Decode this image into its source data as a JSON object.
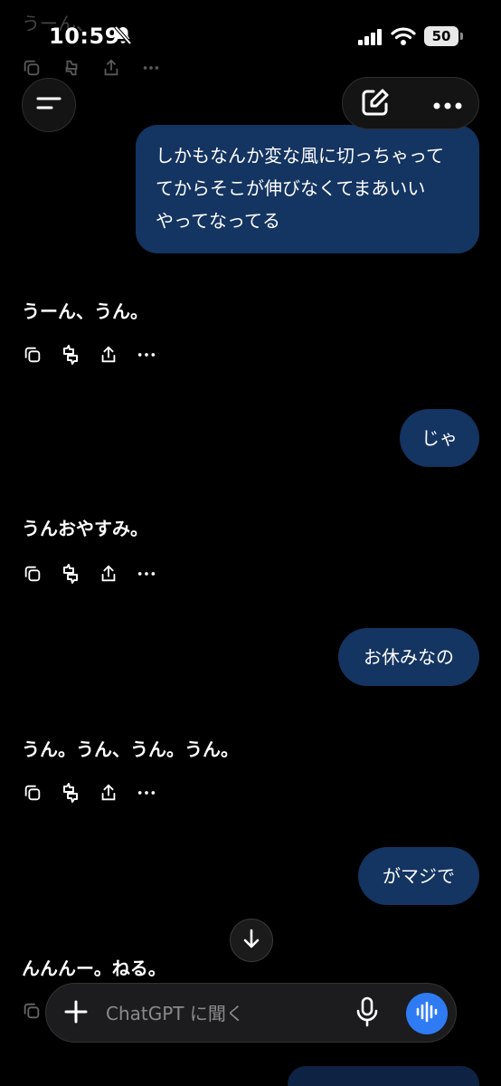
{
  "status_bar": {
    "time": "10:59",
    "battery": "50"
  },
  "top_partial": {
    "text": "うーん、"
  },
  "messages": [
    {
      "role": "user",
      "text": "しかもなんか変な風に切っちゃって\nてからそこが伸びなくてまあいい\nやってなってる"
    },
    {
      "role": "assistant",
      "text": "うーん、うん。"
    },
    {
      "role": "user",
      "text": "じゃ"
    },
    {
      "role": "assistant",
      "text": "うんおやすみ。"
    },
    {
      "role": "user",
      "text": "お休みなの"
    },
    {
      "role": "assistant",
      "text": "うん。うん、うん。うん。"
    },
    {
      "role": "user",
      "text": "がマジで"
    },
    {
      "role": "assistant",
      "text": "んんんー。ねる。"
    }
  ],
  "message_actions": [
    "copy-icon",
    "feedback-icon",
    "share-icon",
    "more-icon"
  ],
  "composer": {
    "placeholder": "ChatGPT に聞く"
  },
  "colors": {
    "user_bubble": "#143461",
    "voice_button": "#2f7bf3",
    "background": "#000000"
  }
}
